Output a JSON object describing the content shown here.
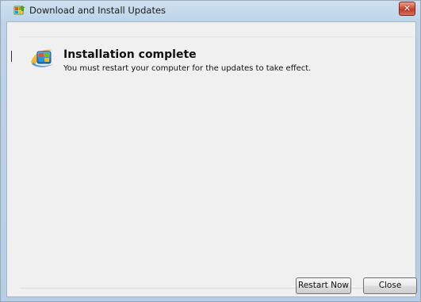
{
  "window": {
    "title": "Download and Install Updates",
    "close_glyph": "✕",
    "title_icon": "windows-update-icon"
  },
  "status": {
    "icon": "windows-update-icon",
    "heading": "Installation complete",
    "message": "You must restart your computer for the updates to take effect."
  },
  "buttons": {
    "restart_label": "Restart Now",
    "close_label": "Close"
  },
  "colors": {
    "title_bar": "#bcd3ea",
    "client_background": "#f0f0f0",
    "close_button": "#c13b24"
  }
}
